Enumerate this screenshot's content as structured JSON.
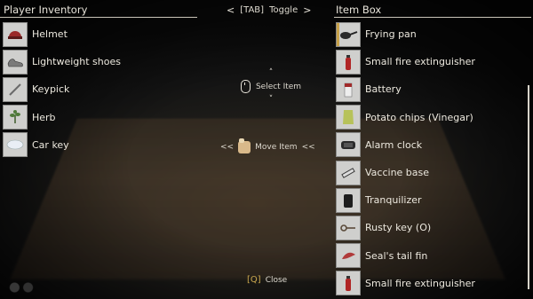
{
  "toggle": {
    "left_arrow": "<",
    "key": "[TAB]",
    "label": "Toggle",
    "right_arrow": ">"
  },
  "left_panel": {
    "title": "Player Inventory",
    "items": [
      {
        "label": "Helmet",
        "icon": "helmet-icon",
        "color": "#9a2a2a"
      },
      {
        "label": "Lightweight shoes",
        "icon": "shoes-icon",
        "color": "#7a7a7a"
      },
      {
        "label": "Keypick",
        "icon": "keypick-icon",
        "color": "#6a6a6a"
      },
      {
        "label": "Herb",
        "icon": "herb-icon",
        "color": "#4f7a3a"
      },
      {
        "label": "Car key",
        "icon": "car-key-icon",
        "color": "#e9eef5"
      }
    ]
  },
  "right_panel": {
    "title": "Item Box",
    "items": [
      {
        "label": "Frying pan",
        "icon": "frying-pan-icon",
        "color": "#2a2a2a"
      },
      {
        "label": "Small fire extinguisher",
        "icon": "fire-extinguisher-icon",
        "color": "#b02525"
      },
      {
        "label": "Battery",
        "icon": "battery-icon",
        "color": "#a02a2a"
      },
      {
        "label": "Potato chips (Vinegar)",
        "icon": "chips-icon",
        "color": "#b7c25a"
      },
      {
        "label": "Alarm clock",
        "icon": "alarm-clock-icon",
        "color": "#2b2b2b"
      },
      {
        "label": "Vaccine base",
        "icon": "vaccine-icon",
        "color": "#3a3a3a"
      },
      {
        "label": "Tranquilizer",
        "icon": "tranquilizer-icon",
        "color": "#1d1d1d"
      },
      {
        "label": "Rusty key (O)",
        "icon": "rusty-key-icon",
        "color": "#5a4a3a"
      },
      {
        "label": "Seal's tail fin",
        "icon": "tail-fin-icon",
        "color": "#b03a3a"
      },
      {
        "label": "Small fire extinguisher",
        "icon": "fire-extinguisher-icon",
        "color": "#b02525"
      }
    ]
  },
  "select_hint": {
    "up": "^",
    "down": "v",
    "label": "Select Item"
  },
  "move_hint": {
    "left": "<<",
    "label": "Move Item",
    "right": "<<"
  },
  "close_hint": {
    "key": "[Q]",
    "label": "Close"
  },
  "colors": {
    "accent": "#c8a24a",
    "text": "#ece8de",
    "divider": "#c9c4b8"
  }
}
